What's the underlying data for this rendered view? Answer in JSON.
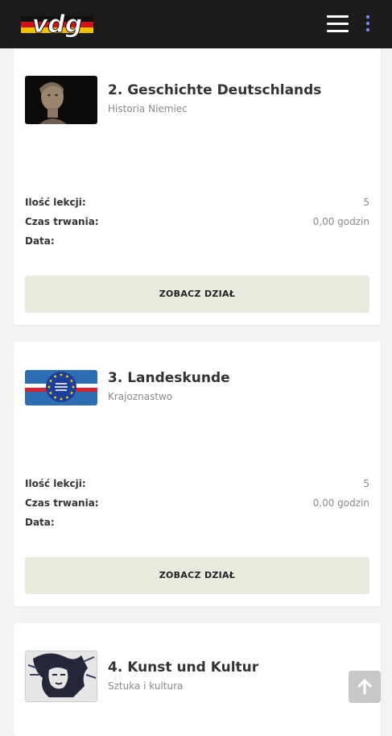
{
  "header": {
    "logo_text": "vdg",
    "menu_icon": "hamburger-icon",
    "more_icon": "vertical-dots-icon"
  },
  "courses": [
    {
      "title": "2. Geschichte Deutschlands",
      "subtitle": "Historia Niemiec",
      "lessons_label": "Ilość lekcji:",
      "lessons_value": "5",
      "duration_label": "Czas trwania:",
      "duration_value": "0,00 godzin",
      "date_label": "Data:",
      "button_label": "ZOBACZ DZIAŁ",
      "thumbnail": "bust-sculpture-image"
    },
    {
      "title": "3. Landeskunde",
      "subtitle": "Krajoznastwo",
      "lessons_label": "Ilość lekcji:",
      "lessons_value": "5",
      "duration_label": "Czas trwania:",
      "duration_value": "0,00 godzin",
      "date_label": "Data:",
      "button_label": "ZOBACZ DZIAŁ",
      "thumbnail": "eu-flag-image"
    },
    {
      "title": "4. Kunst und Kultur",
      "subtitle": "Sztuka i kultura",
      "thumbnail": "beethoven-graffiti-image"
    }
  ],
  "scroll_top_icon": "arrow-up-icon",
  "colors": {
    "topbar": "#1b1b1b",
    "button_bg": "#e9e9de",
    "accent_dots": "#7b8dff",
    "page_bg": "#f3f3f3"
  }
}
